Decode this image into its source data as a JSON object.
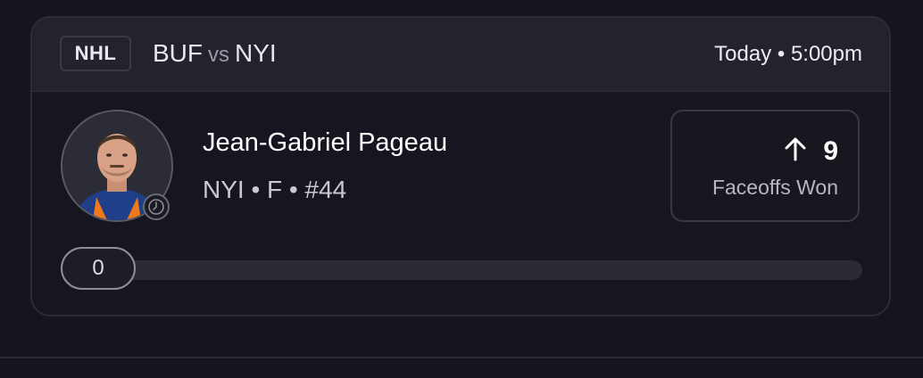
{
  "header": {
    "league": "NHL",
    "home_team": "BUF",
    "vs": "vs",
    "away_team": "NYI",
    "game_time": "Today • 5:00pm"
  },
  "player": {
    "name": "Jean-Gabriel Pageau",
    "meta": "NYI • F • #44",
    "avatar_icon": "player-headshot",
    "status_icon": "clock-icon"
  },
  "stat": {
    "direction_icon": "arrow-up-icon",
    "value": "9",
    "label": "Faceoffs Won"
  },
  "progress": {
    "current_value": "0",
    "fraction": 0
  },
  "colors": {
    "background": "#15151e",
    "card_header": "#23232e",
    "track": "#2b2b36"
  }
}
